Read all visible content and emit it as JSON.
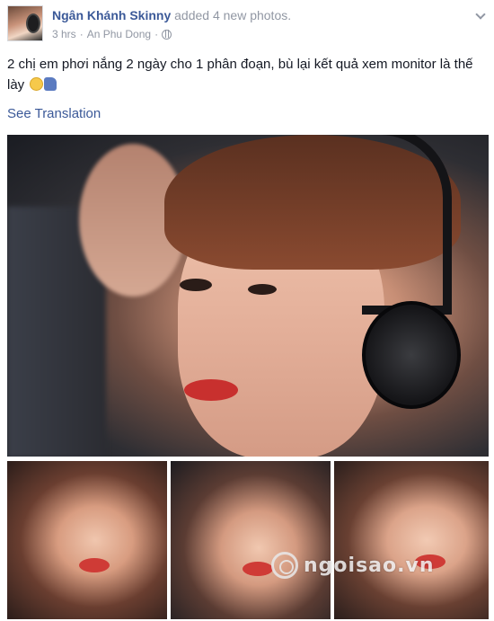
{
  "post": {
    "author": "Ngân Khánh Skinny",
    "action": "added 4 new photos.",
    "time": "3 hrs",
    "separator1": "·",
    "location": "An Phu Dong",
    "separator2": "·",
    "privacy_icon": "globe-icon",
    "menu_icon": "chevron-down-icon",
    "text": "2 chị em phơi nắng 2 ngày cho 1 phân đoạn, bù lại kết quả xem monitor là thế lày",
    "emojis": [
      "grin-emoji-icon",
      "thumbs-up-icon"
    ],
    "see_translation": "See Translation"
  },
  "photos": {
    "count": 4,
    "main": "main-photo",
    "thumbnails": [
      "thumbnail-1",
      "thumbnail-2",
      "thumbnail-3"
    ]
  },
  "watermark": {
    "text": "ngoisao.vn"
  },
  "colors": {
    "link": "#3b5998",
    "meta": "#9197a3",
    "text": "#141823"
  }
}
